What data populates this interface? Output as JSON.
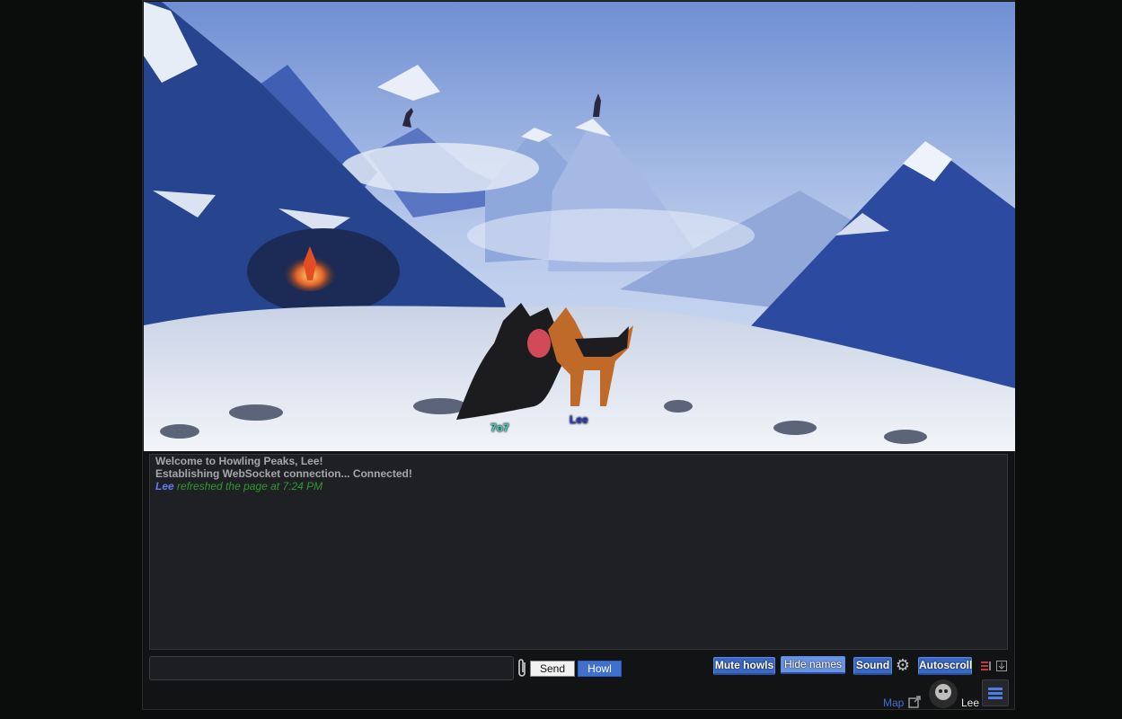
{
  "game": {
    "characters": [
      {
        "name": "7o7",
        "color": "#3fd6c0"
      },
      {
        "name": "Lee",
        "color": "#2a3fcf"
      }
    ]
  },
  "chat": {
    "system_lines": [
      "Welcome to Howling Peaks, Lee!",
      "Establishing WebSocket connection... Connected!"
    ],
    "action": {
      "user": "Lee",
      "text": "refreshed the page at 7:24 PM"
    }
  },
  "input": {
    "value": "",
    "placeholder": ""
  },
  "buttons": {
    "send": "Send",
    "howl": "Howl",
    "mute_howls": "Mute howls",
    "hide_names": "Hide names",
    "sound": "Sound",
    "autoscroll": "Autoscroll"
  },
  "footer": {
    "map_link": "Map",
    "username": "Lee"
  },
  "icons": {
    "attach": "paperclip-icon",
    "settings": "gear-icon",
    "external": "external-link-icon",
    "menu": "hamburger-menu-icon"
  },
  "colors": {
    "accent": "#3a68c4",
    "chat_action": "#2f9a2f",
    "chat_user": "#5c7ef0",
    "background": "#0b0c0c"
  }
}
